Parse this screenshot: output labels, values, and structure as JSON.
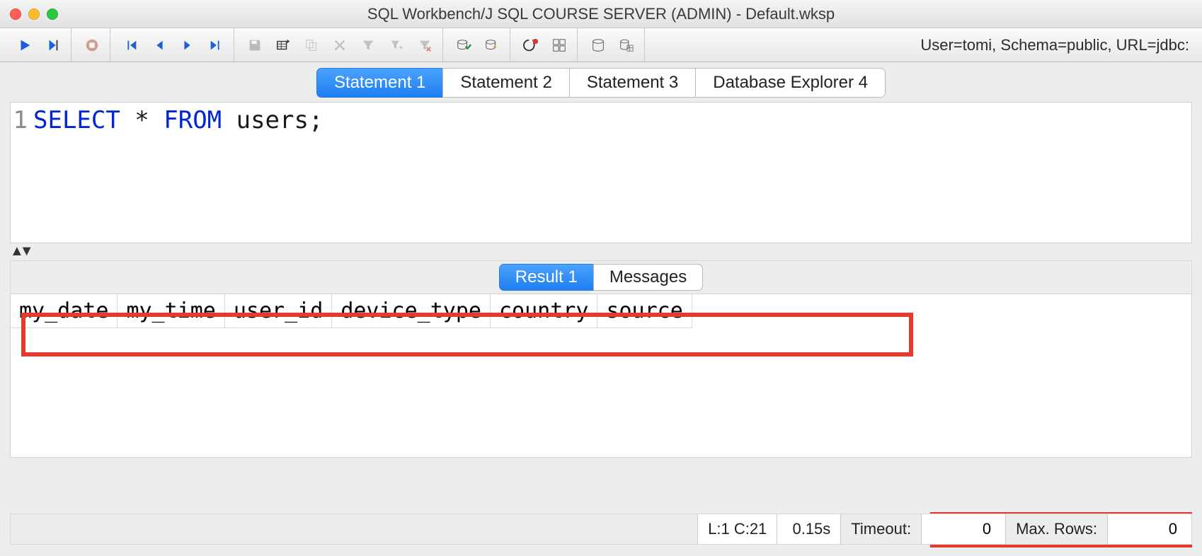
{
  "window": {
    "title": "SQL Workbench/J SQL COURSE SERVER (ADMIN) - Default.wksp"
  },
  "toolbar": {
    "icons": {
      "run": "run-icon",
      "run_to": "run-to-cursor-icon",
      "stop": "stop-icon",
      "first": "nav-first-icon",
      "prev": "nav-prev-icon",
      "next": "nav-next-icon",
      "last": "nav-last-icon",
      "save": "save-icon",
      "insert_row": "table-insert-icon",
      "copy_row": "table-copy-icon",
      "delete_row": "table-delete-icon",
      "filter": "filter-icon",
      "filter_dd": "filter-dropdown-icon",
      "filter_clear": "filter-clear-icon",
      "commit": "db-commit-icon",
      "rollback": "db-rollback-icon",
      "reconnect": "reconnect-icon",
      "grid": "grid-icon",
      "db1": "db-icon",
      "db2": "db-table-icon"
    },
    "info": "User=tomi, Schema=public, URL=jdbc:"
  },
  "tabs": [
    {
      "label": "Statement 1",
      "active": true
    },
    {
      "label": "Statement 2",
      "active": false
    },
    {
      "label": "Statement 3",
      "active": false
    },
    {
      "label": "Database Explorer 4",
      "active": false
    }
  ],
  "editor": {
    "line_number": "1",
    "tokens": {
      "kw1": "SELECT",
      "star": " * ",
      "kw2": "FROM",
      "rest": " users;"
    }
  },
  "result_tabs": [
    {
      "label": "Result 1",
      "active": true
    },
    {
      "label": "Messages",
      "active": false
    }
  ],
  "columns": [
    "my_date",
    "my_time",
    "user_id",
    "device_type",
    "country",
    "source"
  ],
  "status": {
    "cursor": "L:1 C:21",
    "duration": "0.15s",
    "timeout_label": "Timeout:",
    "timeout_value": "0",
    "maxrows_label": "Max. Rows:",
    "maxrows_value": "0"
  }
}
